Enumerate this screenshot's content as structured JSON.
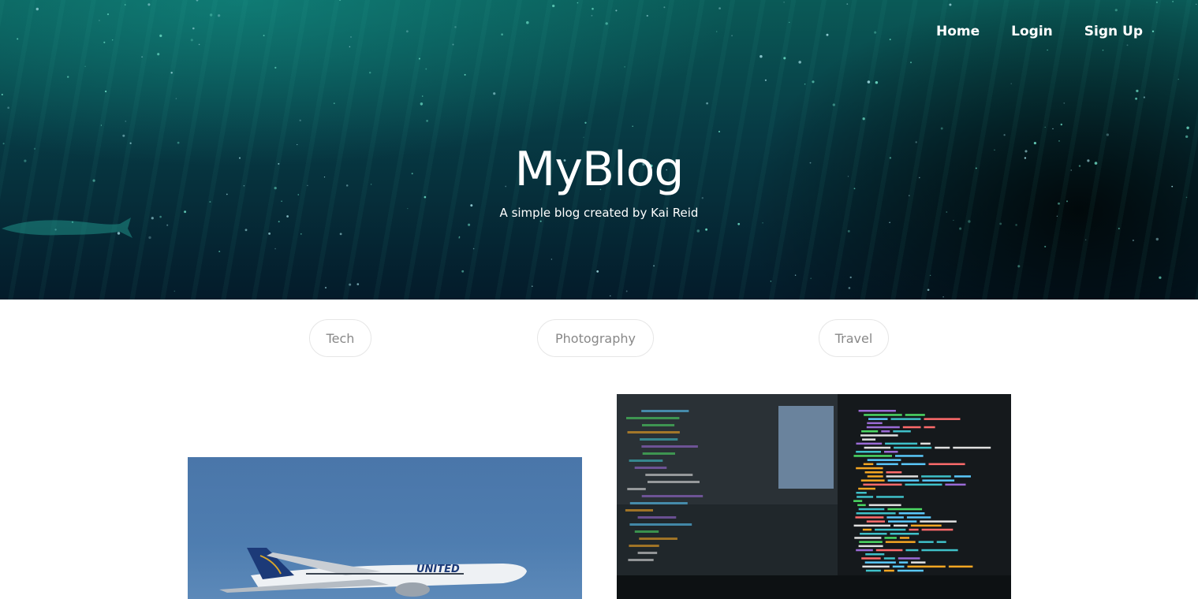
{
  "nav": {
    "home": "Home",
    "login": "Login",
    "signup": "Sign Up"
  },
  "hero": {
    "title": "MyBlog",
    "tagline": "A simple blog created by Kai Reid"
  },
  "categories": [
    "Tech",
    "Photography",
    "Travel"
  ],
  "posts": [
    {
      "image": "airplane-photo",
      "tail_text": "UNITED"
    },
    {
      "image": "code-screens-photo"
    }
  ],
  "colors": {
    "hero_top": "#0a5a57",
    "hero_bottom": "#041b2a",
    "pill_border": "#e6e6e6",
    "pill_text": "#888888",
    "sky": "#4e7db0"
  }
}
